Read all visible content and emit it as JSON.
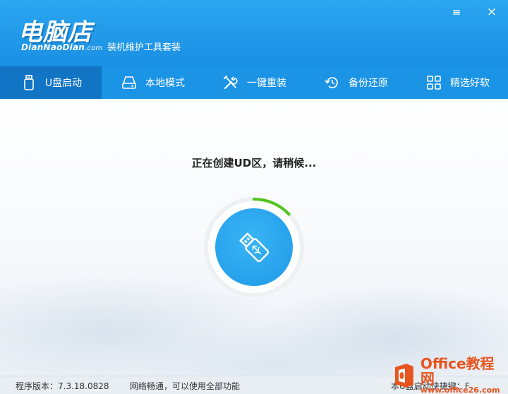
{
  "app": {
    "logo_main": "电脑店",
    "logo_sub": "DianNaoDian",
    "logo_sub_suffix": ".com",
    "subtitle": "装机维护工具套装"
  },
  "window_controls": {
    "minimize": "≡",
    "close": "×"
  },
  "nav": {
    "items": [
      {
        "label": "U盘启动",
        "icon": "usb-drive-icon",
        "active": true
      },
      {
        "label": "本地模式",
        "icon": "hard-disk-icon",
        "active": false
      },
      {
        "label": "一键重装",
        "icon": "tools-icon",
        "active": false
      },
      {
        "label": "备份还原",
        "icon": "restore-icon",
        "active": false
      },
      {
        "label": "精选好软",
        "icon": "apps-grid-icon",
        "active": false
      }
    ]
  },
  "main": {
    "status": "正在创建UD区，请稍候...",
    "progress_fraction": 0.13,
    "center_icon": "usb-stick-icon"
  },
  "statusbar": {
    "version": "程序版本：7.3.18.0828",
    "network": "网络畅通，可以使用全部功能",
    "right_text": "本U盘启动快捷键：F"
  },
  "watermark": {
    "brand": "Office教程网",
    "url": "www.office26.com"
  },
  "colors": {
    "titlebar": "#1a8fe3",
    "nav_active": "#1174c4",
    "progress": "#52c41a",
    "usb_circle": "#1e9ae8",
    "watermark": "#e8541e"
  }
}
